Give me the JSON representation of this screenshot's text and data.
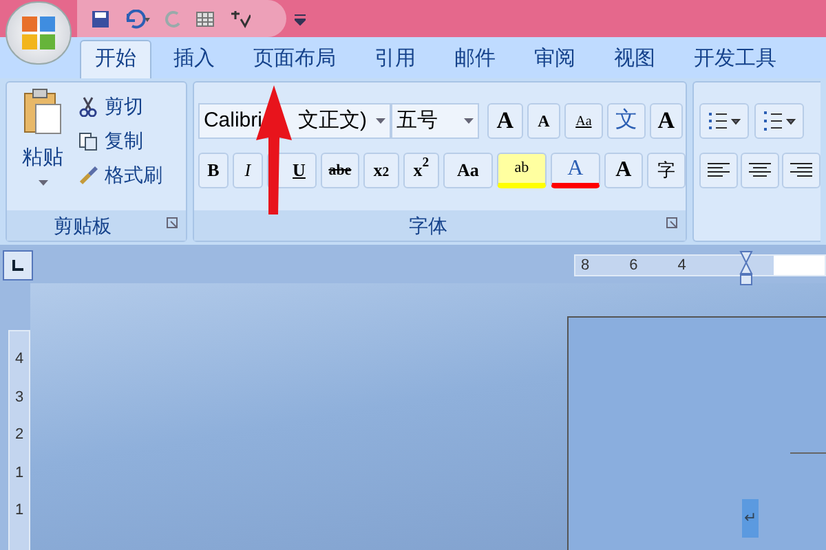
{
  "tabs": [
    {
      "label": "开始",
      "selected": true
    },
    {
      "label": "插入",
      "selected": false
    },
    {
      "label": "页面布局",
      "selected": false
    },
    {
      "label": "引用",
      "selected": false
    },
    {
      "label": "邮件",
      "selected": false
    },
    {
      "label": "审阅",
      "selected": false
    },
    {
      "label": "视图",
      "selected": false
    },
    {
      "label": "开发工具",
      "selected": false
    }
  ],
  "clipboard": {
    "paste": "粘贴",
    "items": [
      {
        "kind": "cut",
        "label": "剪切"
      },
      {
        "kind": "copy",
        "label": "复制"
      },
      {
        "kind": "painter",
        "label": "格式刷"
      }
    ],
    "group_label": "剪贴板"
  },
  "font": {
    "font_name": "Calibri",
    "font_name_rest": "文正文)",
    "font_size": "五号",
    "row1": [
      {
        "kind": "grow",
        "label": "A"
      },
      {
        "kind": "shrink",
        "label": "A"
      },
      {
        "kind": "clear",
        "label": "Aa"
      },
      {
        "kind": "phonetic",
        "label": "文"
      },
      {
        "kind": "border",
        "label": "A"
      }
    ],
    "row2": [
      {
        "kind": "bold",
        "label": "B"
      },
      {
        "kind": "italic",
        "label": "I"
      },
      {
        "kind": "underline",
        "label": "U"
      },
      {
        "kind": "strike",
        "label": "abe"
      },
      {
        "kind": "sub",
        "label": "x$_{2}$"
      },
      {
        "kind": "sup",
        "label": "x$^{2}$"
      },
      {
        "kind": "case",
        "label": "Aa"
      },
      {
        "kind": "highlight",
        "label": "ab"
      },
      {
        "kind": "color",
        "label": "A"
      },
      {
        "kind": "shade",
        "label": "A"
      },
      {
        "kind": "enclose",
        "label": "字"
      }
    ],
    "group_label": "字体"
  },
  "ruler": {
    "horizontal": [
      "8",
      "6",
      "4"
    ],
    "vertical": [
      "4",
      "3",
      "2",
      "1",
      "1"
    ]
  },
  "document": {
    "paragraph_mark": "↵"
  }
}
